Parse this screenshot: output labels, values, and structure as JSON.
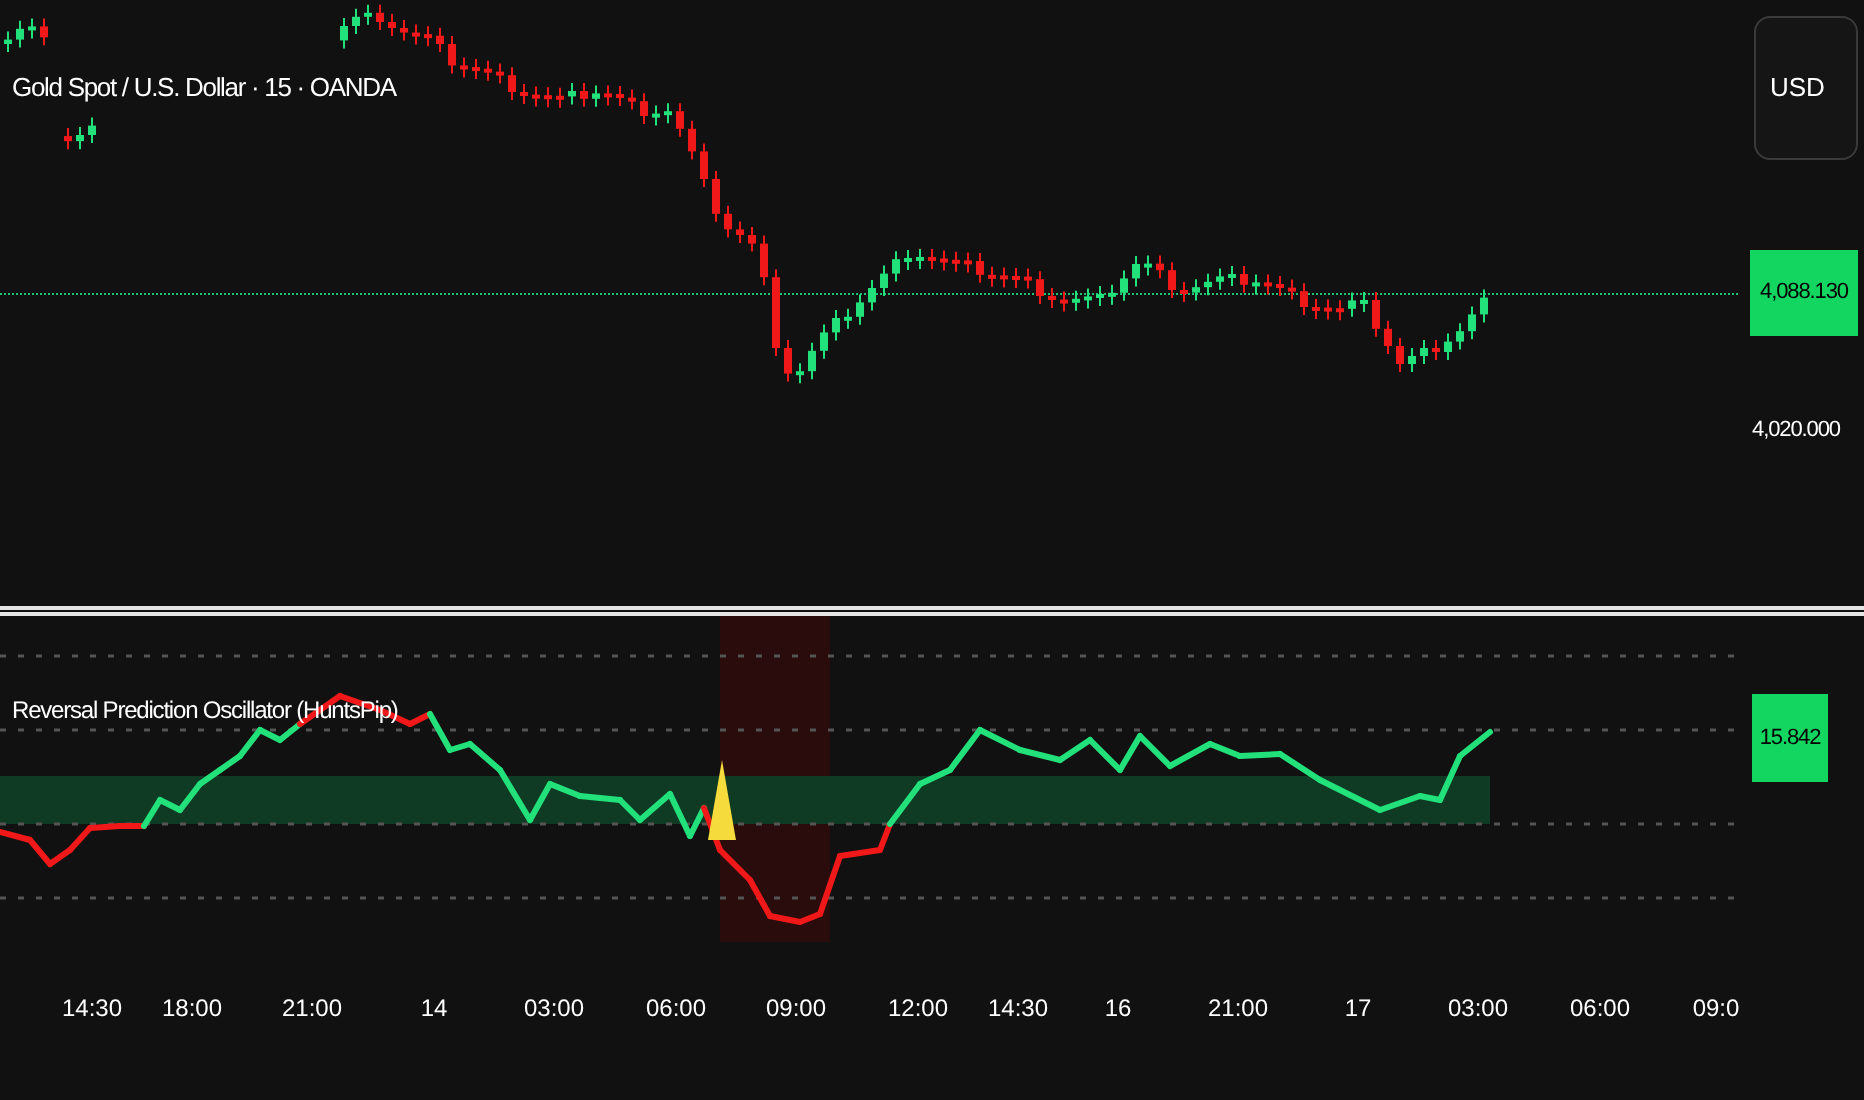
{
  "price_pane": {
    "title": "Gold Spot / U.S. Dollar · 15 · OANDA",
    "currency_button": "USD",
    "last_price": "4,088.130",
    "scale_labels": [
      "4,020.000"
    ]
  },
  "indicator_pane": {
    "title": "Reversal Prediction Oscillator (HuntsPip)",
    "last_value": "15.842"
  },
  "time_axis": [
    "14:30",
    "18:00",
    "21:00",
    "14",
    "03:00",
    "06:00",
    "09:00",
    "12:00",
    "14:30",
    "16",
    "21:00",
    "17",
    "03:00",
    "06:00",
    "09:0"
  ]
}
